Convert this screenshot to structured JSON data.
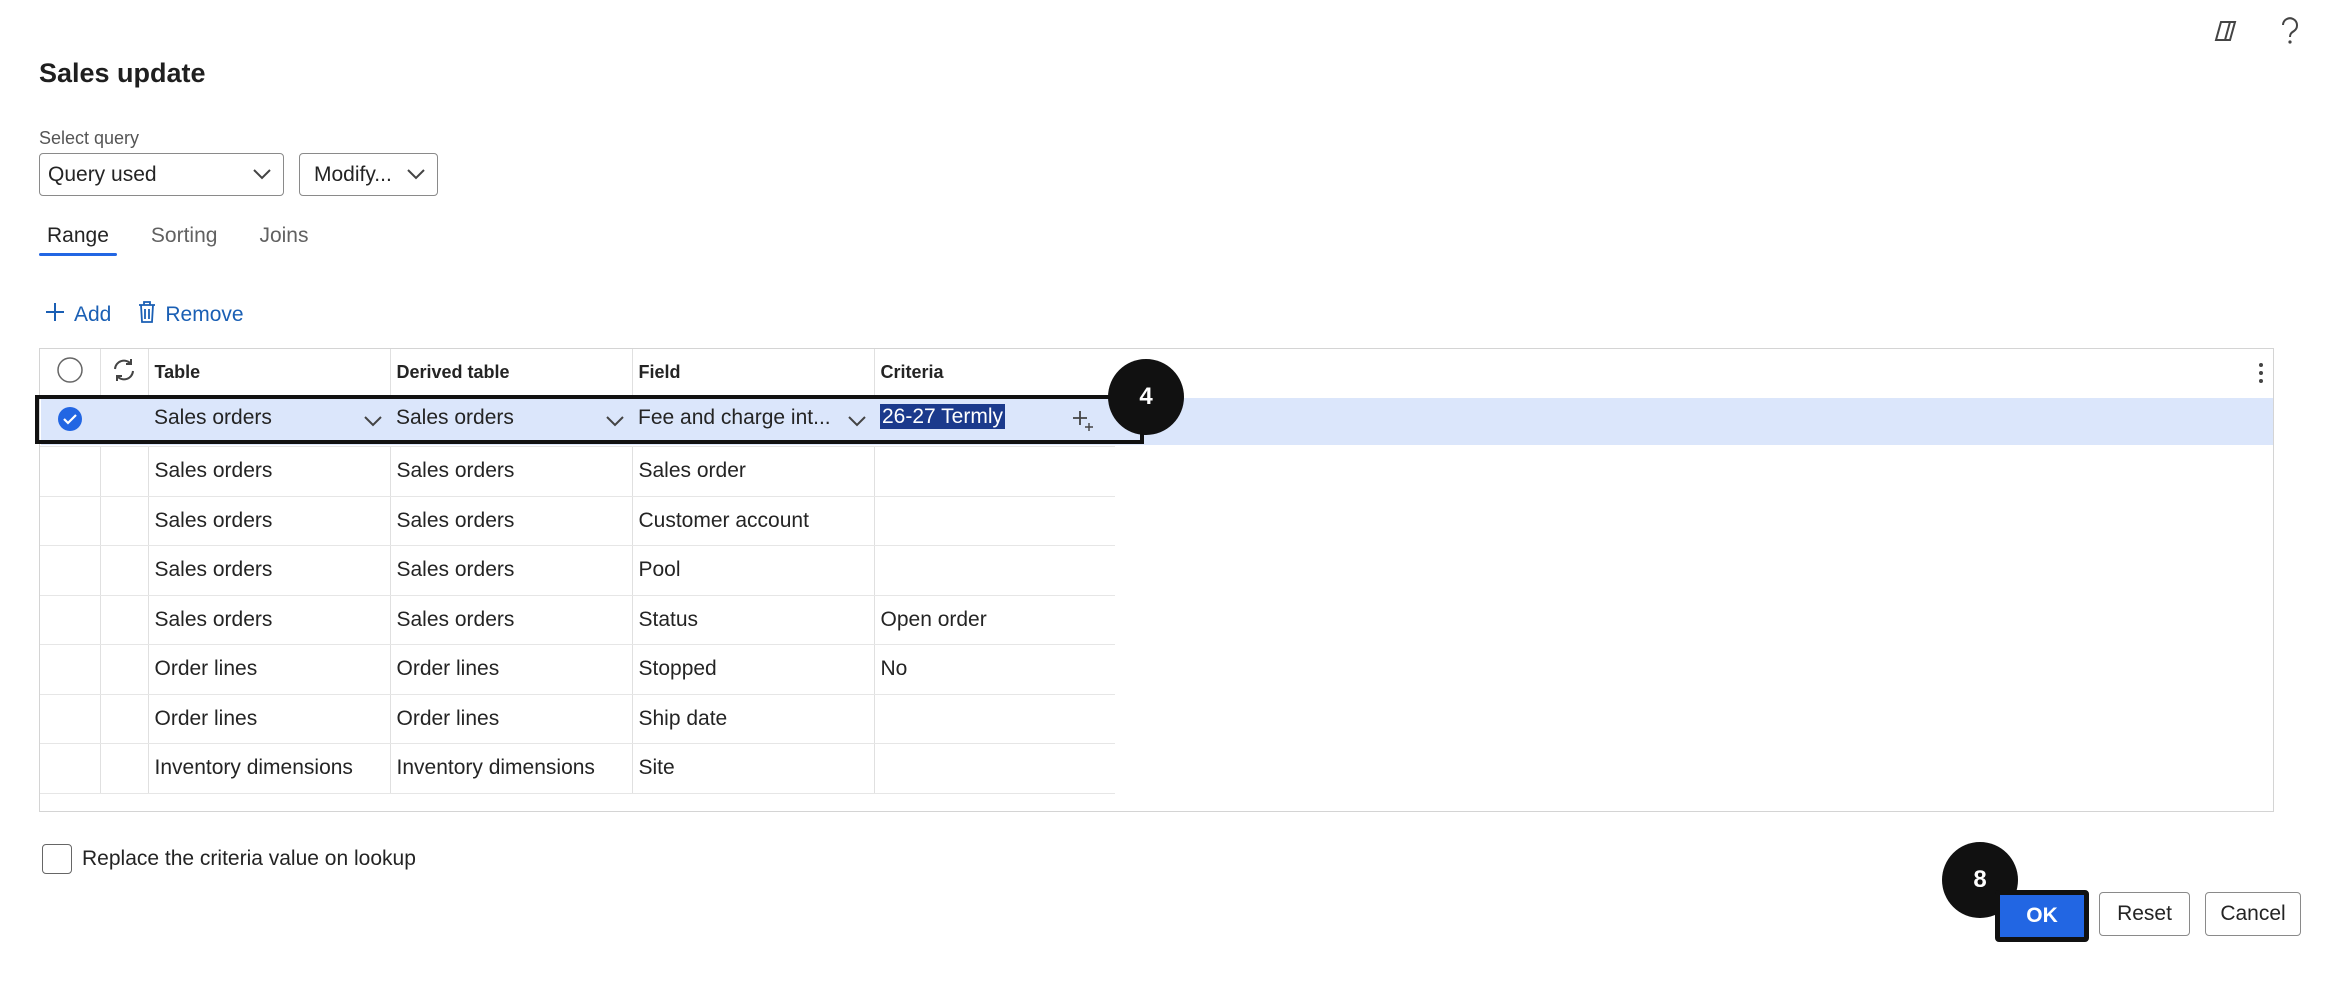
{
  "dialog": {
    "title": "Sales update"
  },
  "top_icons": [
    "copilot-icon",
    "help-icon"
  ],
  "query": {
    "label": "Select query",
    "selected": "Query used",
    "modify_label": "Modify..."
  },
  "tabs": [
    {
      "label": "Range",
      "active": true
    },
    {
      "label": "Sorting",
      "active": false
    },
    {
      "label": "Joins",
      "active": false
    }
  ],
  "toolbar": {
    "add_label": "Add",
    "remove_label": "Remove"
  },
  "grid": {
    "columns": [
      "Table",
      "Derived table",
      "Field",
      "Criteria"
    ],
    "rows": [
      {
        "table": "Sales orders",
        "derived": "Sales orders",
        "field": "Fee and charge int...",
        "criteria": "26-27 Termly",
        "selected": true
      },
      {
        "table": "Sales orders",
        "derived": "Sales orders",
        "field": "Sales order",
        "criteria": ""
      },
      {
        "table": "Sales orders",
        "derived": "Sales orders",
        "field": "Customer account",
        "criteria": ""
      },
      {
        "table": "Sales orders",
        "derived": "Sales orders",
        "field": "Pool",
        "criteria": ""
      },
      {
        "table": "Sales orders",
        "derived": "Sales orders",
        "field": "Status",
        "criteria": "Open order"
      },
      {
        "table": "Order lines",
        "derived": "Order lines",
        "field": "Stopped",
        "criteria": "No"
      },
      {
        "table": "Order lines",
        "derived": "Order lines",
        "field": "Ship date",
        "criteria": ""
      },
      {
        "table": "Inventory dimensions",
        "derived": "Inventory dimensions",
        "field": "Site",
        "criteria": ""
      }
    ]
  },
  "replace_checkbox": {
    "label": "Replace the criteria value on lookup",
    "checked": false
  },
  "buttons": {
    "ok": "OK",
    "reset": "Reset",
    "cancel": "Cancel"
  },
  "badges": {
    "step_a": "4",
    "step_b": "8"
  },
  "colors": {
    "accent": "#2266e3",
    "selected_row": "#dbe6fb",
    "link": "#1a5fb4"
  }
}
